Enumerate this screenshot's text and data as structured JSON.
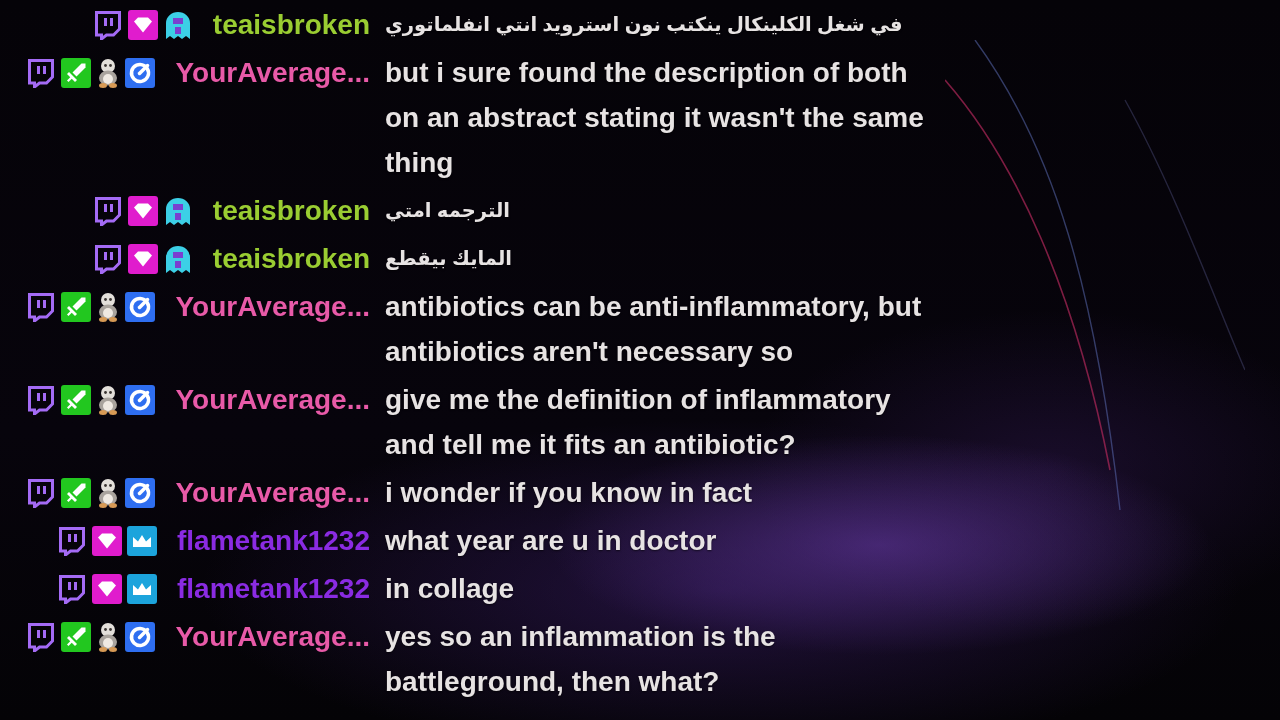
{
  "messages": [
    {
      "username": "teaisbroken",
      "color": "#9acd32",
      "badges": [
        {
          "kind": "bubble"
        },
        {
          "kind": "diamond"
        },
        {
          "kind": "ghost"
        }
      ],
      "text": "في شغل الكلينكال ينكتب نون استرويد انتي انفلماتوري"
    },
    {
      "username": "YourAverage...",
      "color": "#e85aa8",
      "badges": [
        {
          "kind": "bubble"
        },
        {
          "kind": "sword"
        },
        {
          "kind": "figure"
        },
        {
          "kind": "ring"
        }
      ],
      "text": "but i sure found the description of both on an abstract stating it wasn't the same thing"
    },
    {
      "username": "teaisbroken",
      "color": "#9acd32",
      "badges": [
        {
          "kind": "bubble"
        },
        {
          "kind": "diamond"
        },
        {
          "kind": "ghost"
        }
      ],
      "text": "الترجمه امتي"
    },
    {
      "username": "teaisbroken",
      "color": "#9acd32",
      "badges": [
        {
          "kind": "bubble"
        },
        {
          "kind": "diamond"
        },
        {
          "kind": "ghost"
        }
      ],
      "text": "المايك بيقطع"
    },
    {
      "username": "YourAverage...",
      "color": "#e85aa8",
      "badges": [
        {
          "kind": "bubble"
        },
        {
          "kind": "sword"
        },
        {
          "kind": "figure"
        },
        {
          "kind": "ring"
        }
      ],
      "text": "antibiotics can be anti-inflammatory, but antibiotics aren't necessary so"
    },
    {
      "username": "YourAverage...",
      "color": "#e85aa8",
      "badges": [
        {
          "kind": "bubble"
        },
        {
          "kind": "sword"
        },
        {
          "kind": "figure"
        },
        {
          "kind": "ring"
        }
      ],
      "text": "give me the definition of inflammatory and tell me it fits an antibiotic?"
    },
    {
      "username": "YourAverage...",
      "color": "#e85aa8",
      "badges": [
        {
          "kind": "bubble"
        },
        {
          "kind": "sword"
        },
        {
          "kind": "figure"
        },
        {
          "kind": "ring"
        }
      ],
      "text": "i wonder if you know in fact"
    },
    {
      "username": "flametank1232",
      "color": "#8a2be2",
      "badges": [
        {
          "kind": "bubble"
        },
        {
          "kind": "diamond"
        },
        {
          "kind": "crown"
        }
      ],
      "text": "what year are u in doctor"
    },
    {
      "username": "flametank1232",
      "color": "#8a2be2",
      "badges": [
        {
          "kind": "bubble"
        },
        {
          "kind": "diamond"
        },
        {
          "kind": "crown"
        }
      ],
      "text": "in collage"
    },
    {
      "username": "YourAverage...",
      "color": "#e85aa8",
      "badges": [
        {
          "kind": "bubble"
        },
        {
          "kind": "sword"
        },
        {
          "kind": "figure"
        },
        {
          "kind": "ring"
        }
      ],
      "text": "yes so an inflammation is the battleground, then what?"
    }
  ]
}
